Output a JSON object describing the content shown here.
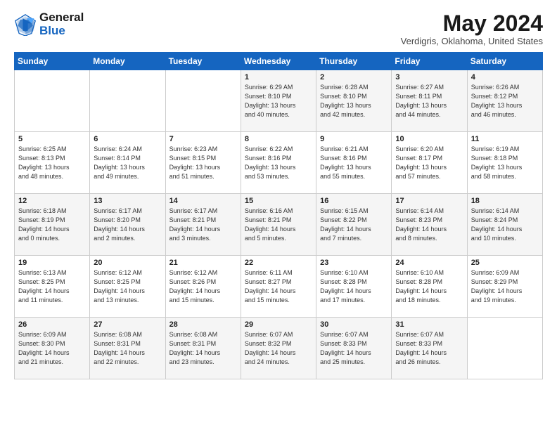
{
  "logo": {
    "line1": "General",
    "line2": "Blue"
  },
  "title": "May 2024",
  "subtitle": "Verdigris, Oklahoma, United States",
  "days_of_week": [
    "Sunday",
    "Monday",
    "Tuesday",
    "Wednesday",
    "Thursday",
    "Friday",
    "Saturday"
  ],
  "weeks": [
    [
      {
        "day": "",
        "info": ""
      },
      {
        "day": "",
        "info": ""
      },
      {
        "day": "",
        "info": ""
      },
      {
        "day": "1",
        "info": "Sunrise: 6:29 AM\nSunset: 8:10 PM\nDaylight: 13 hours\nand 40 minutes."
      },
      {
        "day": "2",
        "info": "Sunrise: 6:28 AM\nSunset: 8:10 PM\nDaylight: 13 hours\nand 42 minutes."
      },
      {
        "day": "3",
        "info": "Sunrise: 6:27 AM\nSunset: 8:11 PM\nDaylight: 13 hours\nand 44 minutes."
      },
      {
        "day": "4",
        "info": "Sunrise: 6:26 AM\nSunset: 8:12 PM\nDaylight: 13 hours\nand 46 minutes."
      }
    ],
    [
      {
        "day": "5",
        "info": "Sunrise: 6:25 AM\nSunset: 8:13 PM\nDaylight: 13 hours\nand 48 minutes."
      },
      {
        "day": "6",
        "info": "Sunrise: 6:24 AM\nSunset: 8:14 PM\nDaylight: 13 hours\nand 49 minutes."
      },
      {
        "day": "7",
        "info": "Sunrise: 6:23 AM\nSunset: 8:15 PM\nDaylight: 13 hours\nand 51 minutes."
      },
      {
        "day": "8",
        "info": "Sunrise: 6:22 AM\nSunset: 8:16 PM\nDaylight: 13 hours\nand 53 minutes."
      },
      {
        "day": "9",
        "info": "Sunrise: 6:21 AM\nSunset: 8:16 PM\nDaylight: 13 hours\nand 55 minutes."
      },
      {
        "day": "10",
        "info": "Sunrise: 6:20 AM\nSunset: 8:17 PM\nDaylight: 13 hours\nand 57 minutes."
      },
      {
        "day": "11",
        "info": "Sunrise: 6:19 AM\nSunset: 8:18 PM\nDaylight: 13 hours\nand 58 minutes."
      }
    ],
    [
      {
        "day": "12",
        "info": "Sunrise: 6:18 AM\nSunset: 8:19 PM\nDaylight: 14 hours\nand 0 minutes."
      },
      {
        "day": "13",
        "info": "Sunrise: 6:17 AM\nSunset: 8:20 PM\nDaylight: 14 hours\nand 2 minutes."
      },
      {
        "day": "14",
        "info": "Sunrise: 6:17 AM\nSunset: 8:21 PM\nDaylight: 14 hours\nand 3 minutes."
      },
      {
        "day": "15",
        "info": "Sunrise: 6:16 AM\nSunset: 8:21 PM\nDaylight: 14 hours\nand 5 minutes."
      },
      {
        "day": "16",
        "info": "Sunrise: 6:15 AM\nSunset: 8:22 PM\nDaylight: 14 hours\nand 7 minutes."
      },
      {
        "day": "17",
        "info": "Sunrise: 6:14 AM\nSunset: 8:23 PM\nDaylight: 14 hours\nand 8 minutes."
      },
      {
        "day": "18",
        "info": "Sunrise: 6:14 AM\nSunset: 8:24 PM\nDaylight: 14 hours\nand 10 minutes."
      }
    ],
    [
      {
        "day": "19",
        "info": "Sunrise: 6:13 AM\nSunset: 8:25 PM\nDaylight: 14 hours\nand 11 minutes."
      },
      {
        "day": "20",
        "info": "Sunrise: 6:12 AM\nSunset: 8:25 PM\nDaylight: 14 hours\nand 13 minutes."
      },
      {
        "day": "21",
        "info": "Sunrise: 6:12 AM\nSunset: 8:26 PM\nDaylight: 14 hours\nand 15 minutes."
      },
      {
        "day": "22",
        "info": "Sunrise: 6:11 AM\nSunset: 8:27 PM\nDaylight: 14 hours\nand 15 minutes."
      },
      {
        "day": "23",
        "info": "Sunrise: 6:10 AM\nSunset: 8:28 PM\nDaylight: 14 hours\nand 17 minutes."
      },
      {
        "day": "24",
        "info": "Sunrise: 6:10 AM\nSunset: 8:28 PM\nDaylight: 14 hours\nand 18 minutes."
      },
      {
        "day": "25",
        "info": "Sunrise: 6:09 AM\nSunset: 8:29 PM\nDaylight: 14 hours\nand 19 minutes."
      }
    ],
    [
      {
        "day": "26",
        "info": "Sunrise: 6:09 AM\nSunset: 8:30 PM\nDaylight: 14 hours\nand 21 minutes."
      },
      {
        "day": "27",
        "info": "Sunrise: 6:08 AM\nSunset: 8:31 PM\nDaylight: 14 hours\nand 22 minutes."
      },
      {
        "day": "28",
        "info": "Sunrise: 6:08 AM\nSunset: 8:31 PM\nDaylight: 14 hours\nand 23 minutes."
      },
      {
        "day": "29",
        "info": "Sunrise: 6:07 AM\nSunset: 8:32 PM\nDaylight: 14 hours\nand 24 minutes."
      },
      {
        "day": "30",
        "info": "Sunrise: 6:07 AM\nSunset: 8:33 PM\nDaylight: 14 hours\nand 25 minutes."
      },
      {
        "day": "31",
        "info": "Sunrise: 6:07 AM\nSunset: 8:33 PM\nDaylight: 14 hours\nand 26 minutes."
      },
      {
        "day": "",
        "info": ""
      }
    ]
  ]
}
